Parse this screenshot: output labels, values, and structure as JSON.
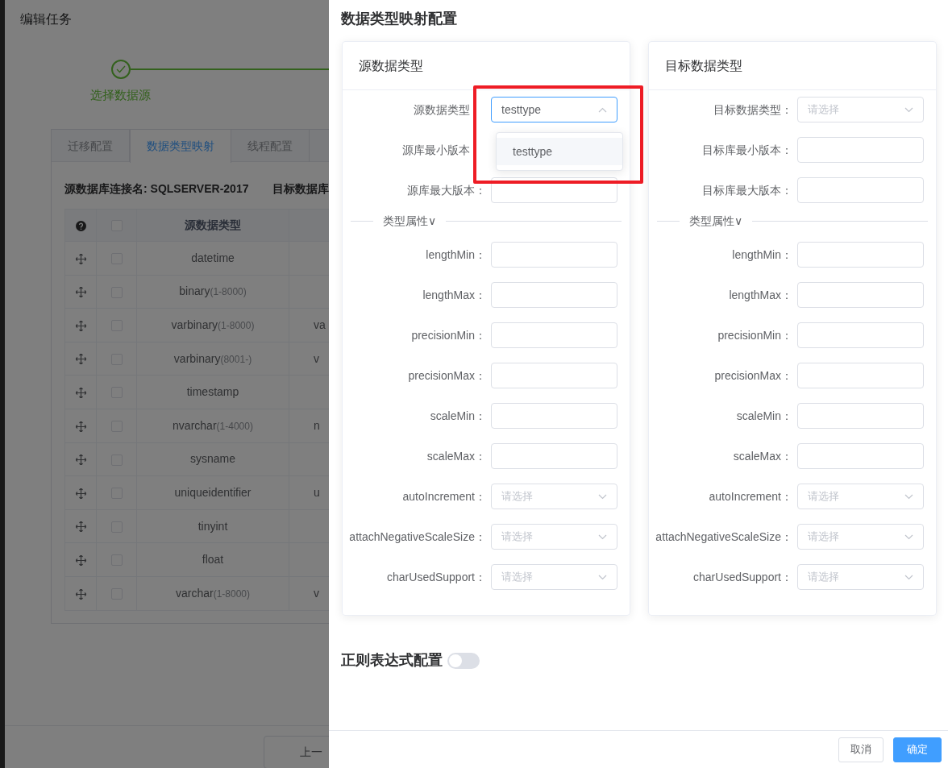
{
  "background_page": {
    "title": "编辑任务",
    "steps": [
      {
        "label": "选择数据源",
        "completed": true
      }
    ],
    "tabs": [
      {
        "label": "迁移配置",
        "selected": false
      },
      {
        "label": "数据类型映射",
        "selected": true
      },
      {
        "label": "线程配置",
        "selected": false
      }
    ],
    "connection": {
      "label": "源数据库连接名:",
      "value": "SQLSERVER-2017",
      "target_label": "目标数据库"
    },
    "table": {
      "columns": [
        "源数据类型"
      ],
      "header_checked": false,
      "rows": [
        {
          "name": "datetime",
          "checked": false
        },
        {
          "name": "binary",
          "range": "(1-8000)",
          "checked": false
        },
        {
          "name": "varbinary",
          "range": "(1-8000)",
          "column_2": "va",
          "checked": false
        },
        {
          "name": "varbinary",
          "range": "(8001-)",
          "column_2": "v",
          "checked": false
        },
        {
          "name": "timestamp",
          "checked": false
        },
        {
          "name": "nvarchar",
          "range": "(1-4000)",
          "column_2": "n",
          "checked": false
        },
        {
          "name": "sysname",
          "checked": false
        },
        {
          "name": "uniqueidentifier",
          "column_2": "u",
          "checked": false
        },
        {
          "name": "tinyint",
          "checked": false
        },
        {
          "name": "float",
          "checked": false
        },
        {
          "name": "varchar",
          "range": "(1-8000)",
          "column_2": "v",
          "checked": false
        }
      ]
    },
    "prev_button": "上一"
  },
  "drawer": {
    "title": "数据类型映射配置",
    "panels": [
      {
        "title": "源数据类型",
        "fields": [
          {
            "label": "源数据类型",
            "kind": "select",
            "value": "testtype",
            "open": true,
            "options": [
              {
                "label": "testtype",
                "highlighted": true
              }
            ]
          },
          {
            "label": "源库最小版本",
            "kind": "input"
          },
          {
            "label": "源库最大版本：",
            "kind": "input"
          }
        ],
        "section": "类型属性∨",
        "attributes": [
          {
            "label": "lengthMin：",
            "kind": "input"
          },
          {
            "label": "lengthMax：",
            "kind": "input"
          },
          {
            "label": "precisionMin：",
            "kind": "input"
          },
          {
            "label": "precisionMax：",
            "kind": "input"
          },
          {
            "label": "scaleMin：",
            "kind": "input"
          },
          {
            "label": "scaleMax：",
            "kind": "input"
          },
          {
            "label": "autoIncrement：",
            "kind": "select",
            "placeholder": "请选择",
            "open": false
          },
          {
            "label": "attachNegativeScaleSize：",
            "kind": "select",
            "placeholder": "请选择",
            "open": false
          },
          {
            "label": "charUsedSupport：",
            "kind": "select",
            "placeholder": "请选择",
            "open": false
          }
        ]
      },
      {
        "title": "目标数据类型",
        "fields": [
          {
            "label": "目标数据类型：",
            "kind": "select",
            "placeholder": "请选择",
            "open": false
          },
          {
            "label": "目标库最小版本：",
            "kind": "input"
          },
          {
            "label": "目标库最大版本：",
            "kind": "input"
          }
        ],
        "section": "类型属性∨",
        "attributes": [
          {
            "label": "lengthMin：",
            "kind": "input"
          },
          {
            "label": "lengthMax：",
            "kind": "input"
          },
          {
            "label": "precisionMin：",
            "kind": "input"
          },
          {
            "label": "precisionMax：",
            "kind": "input"
          },
          {
            "label": "scaleMin：",
            "kind": "input"
          },
          {
            "label": "scaleMax：",
            "kind": "input"
          },
          {
            "label": "autoIncrement：",
            "kind": "select",
            "placeholder": "请选择",
            "open": false
          },
          {
            "label": "attachNegativeScaleSize：",
            "kind": "select",
            "placeholder": "请选择",
            "open": false
          },
          {
            "label": "charUsedSupport：",
            "kind": "select",
            "placeholder": "请选择",
            "open": false
          }
        ]
      }
    ],
    "regex": {
      "title": "正则表达式配置",
      "on": false
    },
    "buttons": [
      {
        "label": "取消",
        "kind": "default"
      },
      {
        "label": "确定",
        "kind": "primary"
      }
    ]
  }
}
